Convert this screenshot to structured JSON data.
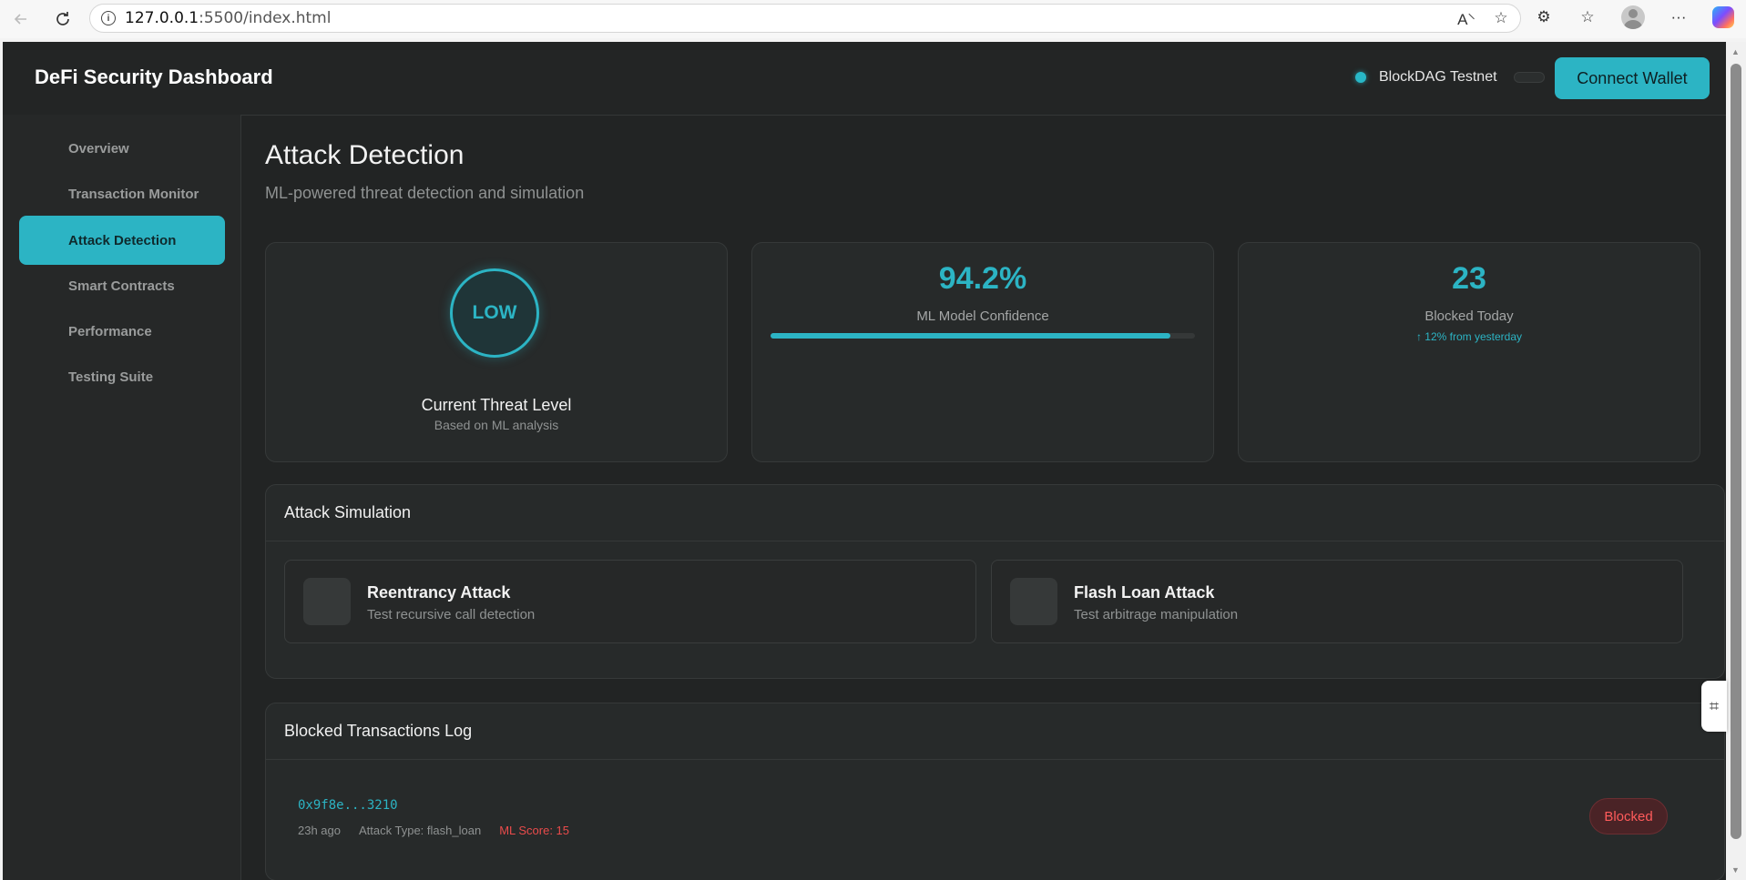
{
  "browser": {
    "url_host": "127.0.0.1",
    "url_path": ":5500/index.html",
    "icons": [
      "back-arrow-icon",
      "reload-icon",
      "info-icon",
      "read-aloud-icon",
      "favorite-star-icon",
      "extensions-icon",
      "favorites-icon",
      "profile-icon",
      "more-icon",
      "copilot-icon"
    ]
  },
  "header": {
    "brand": "DeFi Security Dashboard",
    "network_label": "BlockDAG Testnet",
    "connect_label": "Connect Wallet"
  },
  "sidebar": {
    "items": [
      {
        "label": "Overview"
      },
      {
        "label": "Transaction Monitor"
      },
      {
        "label": "Attack Detection",
        "active": true
      },
      {
        "label": "Smart Contracts"
      },
      {
        "label": "Performance"
      },
      {
        "label": "Testing Suite"
      }
    ]
  },
  "page": {
    "title": "Attack Detection",
    "subtitle": "ML-powered threat detection and simulation"
  },
  "stats": {
    "threat": {
      "level": "LOW",
      "title": "Current Threat Level",
      "subtitle": "Based on ML analysis"
    },
    "confidence": {
      "value": "94.2%",
      "label": "ML Model Confidence",
      "fraction": 0.942
    },
    "blocked": {
      "value": "23",
      "label": "Blocked Today",
      "trend": "↑ 12% from yesterday"
    }
  },
  "simulation": {
    "title": "Attack Simulation",
    "attacks": [
      {
        "name": "Reentrancy Attack",
        "description": "Test recursive call detection"
      },
      {
        "name": "Flash Loan Attack",
        "description": "Test arbitrage manipulation"
      }
    ]
  },
  "log": {
    "title": "Blocked Transactions Log",
    "entries": [
      {
        "hash": "0x9f8e...3210",
        "time": "23h ago",
        "attack_type": "Attack Type: flash_loan",
        "ml_score": "ML Score: 15",
        "status": "Blocked"
      }
    ]
  },
  "colors": {
    "accent": "#2cb4c4",
    "danger": "#e94b4b",
    "background": "#222424"
  }
}
